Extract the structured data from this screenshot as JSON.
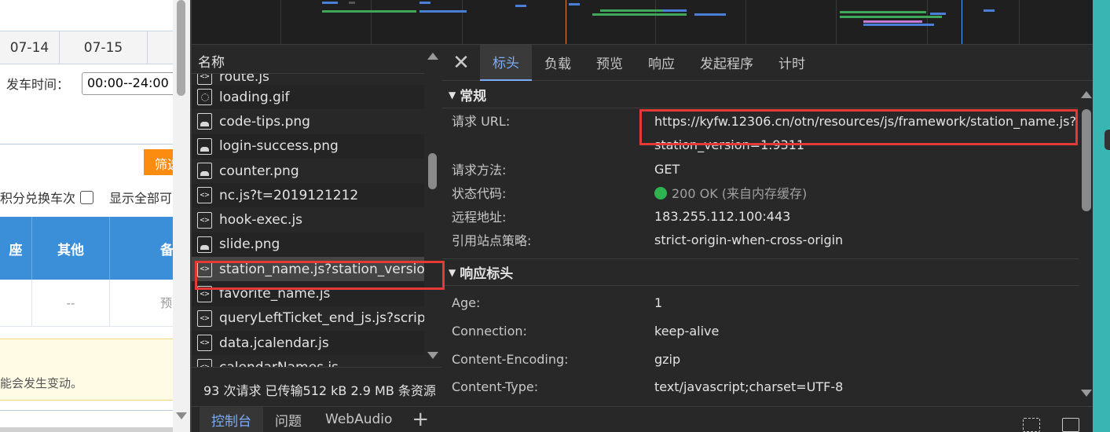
{
  "page": {
    "dates": [
      "07-14",
      "07-15",
      ""
    ],
    "departure_label": "发车时间：",
    "departure_value": "00:00--24:00",
    "filter_button": "筛选",
    "options_text": "积分兑换车次",
    "show_all_text": "显示全部可",
    "table_headers": [
      "座",
      "其他",
      "备"
    ],
    "table_row": [
      "",
      "--",
      "预"
    ],
    "notice_text": "能会发生变动。"
  },
  "devtools": {
    "name_column_header": "名称",
    "files": [
      {
        "name": "route.js",
        "type": "js"
      },
      {
        "name": "loading.gif",
        "type": "gif"
      },
      {
        "name": "code-tips.png",
        "type": "png"
      },
      {
        "name": "login-success.png",
        "type": "png"
      },
      {
        "name": "counter.png",
        "type": "png"
      },
      {
        "name": "nc.js?t=2019121212",
        "type": "js"
      },
      {
        "name": "hook-exec.js",
        "type": "js"
      },
      {
        "name": "slide.png",
        "type": "png"
      },
      {
        "name": "station_name.js?station_versio...",
        "type": "js",
        "selected": true
      },
      {
        "name": "favorite_name.js",
        "type": "js"
      },
      {
        "name": "queryLeftTicket_end_js.js?scrip...",
        "type": "js"
      },
      {
        "name": "data.jcalendar.js",
        "type": "js"
      },
      {
        "name": "calendarNames.js",
        "type": "js"
      }
    ],
    "summary": "93 次请求  已传输512 kB  2.9 MB 条资源",
    "tabs": [
      "标头",
      "负载",
      "预览",
      "响应",
      "发起程序",
      "计时"
    ],
    "active_tab": "标头",
    "general_section": "常规",
    "general": {
      "request_url_label": "请求 URL:",
      "request_url_value": "https://kyfw.12306.cn/otn/resources/js/framework/station_name.js?station_version=1.9311",
      "method_label": "请求方法:",
      "method_value": "GET",
      "status_label": "状态代码:",
      "status_value": "200 OK (来自内存缓存)",
      "status_color": "#2fb350",
      "remote_label": "远程地址:",
      "remote_value": "183.255.112.100:443",
      "referrer_label": "引用站点策略:",
      "referrer_value": "strict-origin-when-cross-origin"
    },
    "response_section": "响应标头",
    "response_headers": [
      {
        "key": "Age:",
        "value": "1"
      },
      {
        "key": "Connection:",
        "value": "keep-alive"
      },
      {
        "key": "Content-Encoding:",
        "value": "gzip"
      },
      {
        "key": "Content-Type:",
        "value": "text/javascript;charset=UTF-8"
      }
    ],
    "drawer_tabs": [
      "控制台",
      "问题",
      "WebAudio"
    ],
    "drawer_plus": "+",
    "accent_color": "#7cacf8",
    "highlight_color": "#e53935"
  }
}
